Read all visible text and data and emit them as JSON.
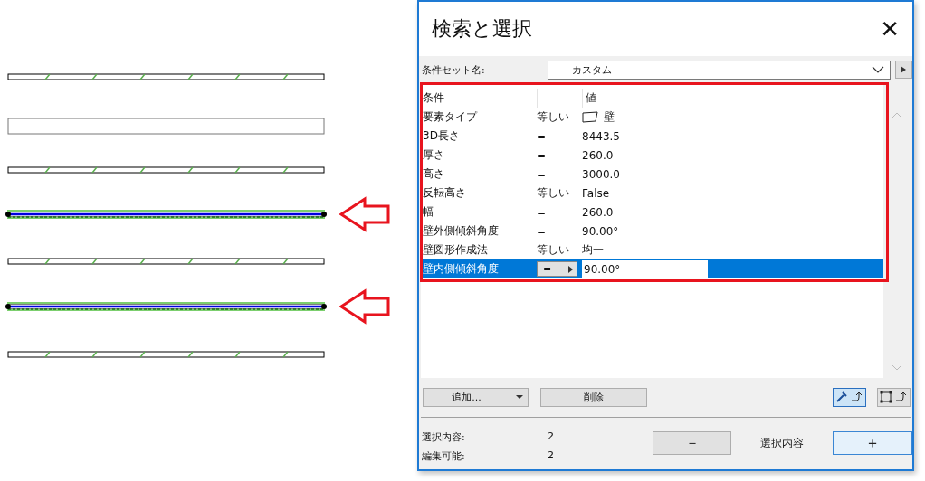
{
  "canvas": {
    "walls": [
      {
        "kind": "hatched",
        "selected": false
      },
      {
        "kind": "plain",
        "selected": false
      },
      {
        "kind": "hatched",
        "selected": false
      },
      {
        "kind": "hatched",
        "selected": true
      },
      {
        "kind": "hatched",
        "selected": false
      },
      {
        "kind": "hatched",
        "selected": true
      },
      {
        "kind": "hatched",
        "selected": false
      }
    ]
  },
  "window": {
    "title": "検索と選択",
    "close": "✕"
  },
  "criteria_set": {
    "label": "条件セット名:",
    "value": "カスタム"
  },
  "table": {
    "highlighted": true,
    "columns": [
      "条件",
      "値"
    ],
    "rows": [
      {
        "kind": "type",
        "name": "要素タイプ",
        "operator": "等しい",
        "value": "壁",
        "selected": false
      },
      {
        "kind": "text",
        "name": "3D長さ",
        "operator": "=",
        "value": "8443.5",
        "selected": false
      },
      {
        "kind": "text",
        "name": "厚さ",
        "operator": "=",
        "value": "260.0",
        "selected": false
      },
      {
        "kind": "text",
        "name": "高さ",
        "operator": "=",
        "value": "3000.0",
        "selected": false
      },
      {
        "kind": "text",
        "name": "反転高さ",
        "operator": "等しい",
        "value": "False",
        "selected": false
      },
      {
        "kind": "text",
        "name": "幅",
        "operator": "=",
        "value": "260.0",
        "selected": false
      },
      {
        "kind": "text",
        "name": "壁外側傾斜角度",
        "operator": "=",
        "value": "90.00°",
        "selected": false
      },
      {
        "kind": "text",
        "name": "壁図形作成法",
        "operator": "等しい",
        "value": "均一",
        "selected": false
      },
      {
        "kind": "text",
        "name": "壁内側傾斜角度",
        "operator": "=",
        "value": "90.00°",
        "selected": true
      }
    ]
  },
  "buttons": {
    "add": "追加...",
    "delete": "削除"
  },
  "mode_toggles": [
    {
      "kind": "pick",
      "selected": true
    },
    {
      "kind": "marquee",
      "selected": false
    }
  ],
  "stats": [
    {
      "label": "選択内容:",
      "value": "2"
    },
    {
      "label": "編集可能:",
      "value": "2"
    }
  ],
  "selection": {
    "minus": "－",
    "label": "選択内容",
    "plus": "＋"
  }
}
